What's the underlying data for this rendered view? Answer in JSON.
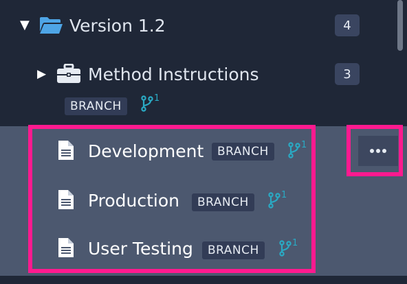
{
  "tree": {
    "version": {
      "label": "Version 1.2",
      "count": "4",
      "expanded_caret": "▼",
      "icon": "folder-open-icon"
    },
    "method": {
      "label": "Method Instructions",
      "count": "3",
      "collapsed_caret": "▶",
      "icon": "briefcase-icon",
      "badge": "BRANCH",
      "branch_count": "1"
    },
    "items": [
      {
        "label": "Development",
        "badge": "BRANCH",
        "branch_count": "1",
        "icon": "document-icon"
      },
      {
        "label": "Production",
        "badge": "BRANCH",
        "branch_count": "1",
        "icon": "document-icon"
      },
      {
        "label": "User Testing",
        "badge": "BRANCH",
        "branch_count": "1",
        "icon": "document-icon"
      }
    ]
  },
  "colors": {
    "background": "#1f2737",
    "selected": "#4c586f",
    "highlight": "#fe1a8f",
    "branch_icon": "#2aa9c3",
    "folder_icon": "#4ea5e6"
  }
}
